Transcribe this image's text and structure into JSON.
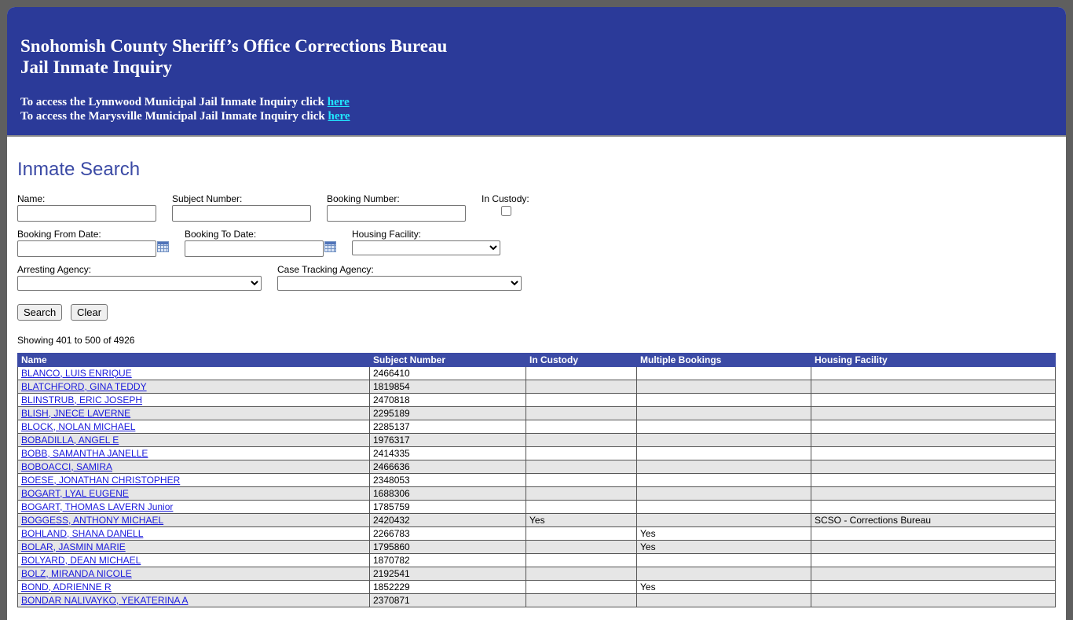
{
  "banner": {
    "title_line1": "Snohomish County Sheriff’s Office Corrections Bureau",
    "title_line2": "Jail Inmate Inquiry",
    "link1_prefix": "To access the Lynnwood Municipal Jail Inmate Inquiry click ",
    "link1_text": "here",
    "link2_prefix": "To access the Marysville Municipal Jail Inmate Inquiry click ",
    "link2_text": "here",
    "colors": {
      "background": "#2b3a99",
      "link": "#21e6ff"
    }
  },
  "search": {
    "title": "Inmate Search",
    "name_label": "Name:",
    "name_value": "",
    "subject_label": "Subject Number:",
    "subject_value": "",
    "booking_label": "Booking Number:",
    "booking_value": "",
    "custody_label": "In Custody:",
    "custody_checked": false,
    "from_label": "Booking From Date:",
    "from_value": "",
    "to_label": "Booking To Date:",
    "to_value": "",
    "housing_label": "Housing Facility:",
    "housing_selected": "",
    "arresting_label": "Arresting Agency:",
    "arresting_selected": "",
    "case_label": "Case Tracking Agency:",
    "case_selected": "",
    "search_button": "Search",
    "clear_button": "Clear",
    "calendar_icon": "calendar-icon"
  },
  "results": {
    "showing": "Showing 401 to 500 of 4926",
    "header_color": "#3b4aa5",
    "columns": [
      "Name",
      "Subject Number",
      "In Custody",
      "Multiple Bookings",
      "Housing Facility"
    ],
    "rows": [
      [
        "BLANCO, LUIS ENRIQUE",
        "2466410",
        "",
        "",
        ""
      ],
      [
        "BLATCHFORD, GINA TEDDY",
        "1819854",
        "",
        "",
        ""
      ],
      [
        "BLINSTRUB, ERIC JOSEPH",
        "2470818",
        "",
        "",
        ""
      ],
      [
        "BLISH, JNECE LAVERNE",
        "2295189",
        "",
        "",
        ""
      ],
      [
        "BLOCK, NOLAN MICHAEL",
        "2285137",
        "",
        "",
        ""
      ],
      [
        "BOBADILLA, ANGEL E",
        "1976317",
        "",
        "",
        ""
      ],
      [
        "BOBB, SAMANTHA JANELLE",
        "2414335",
        "",
        "",
        ""
      ],
      [
        "BOBOACCI, SAMIRA",
        "2466636",
        "",
        "",
        ""
      ],
      [
        "BOESE, JONATHAN CHRISTOPHER",
        "2348053",
        "",
        "",
        ""
      ],
      [
        "BOGART, LYAL EUGENE",
        "1688306",
        "",
        "",
        ""
      ],
      [
        "BOGART, THOMAS LAVERN Junior",
        "1785759",
        "",
        "",
        ""
      ],
      [
        "BOGGESS, ANTHONY MICHAEL",
        "2420432",
        "Yes",
        "",
        "SCSO - Corrections Bureau"
      ],
      [
        "BOHLAND, SHANA DANELL",
        "2266783",
        "",
        "Yes",
        ""
      ],
      [
        "BOLAR, JASMIN MARIE",
        "1795860",
        "",
        "Yes",
        ""
      ],
      [
        "BOLYARD, DEAN MICHAEL",
        "1870782",
        "",
        "",
        ""
      ],
      [
        "BOLZ, MIRANDA NICOLE",
        "2192541",
        "",
        "",
        ""
      ],
      [
        "BOND, ADRIENNE R",
        "1852229",
        "",
        "Yes",
        ""
      ],
      [
        "BONDAR NALIVAYKO, YEKATERINA A",
        "2370871",
        "",
        "",
        ""
      ]
    ]
  }
}
